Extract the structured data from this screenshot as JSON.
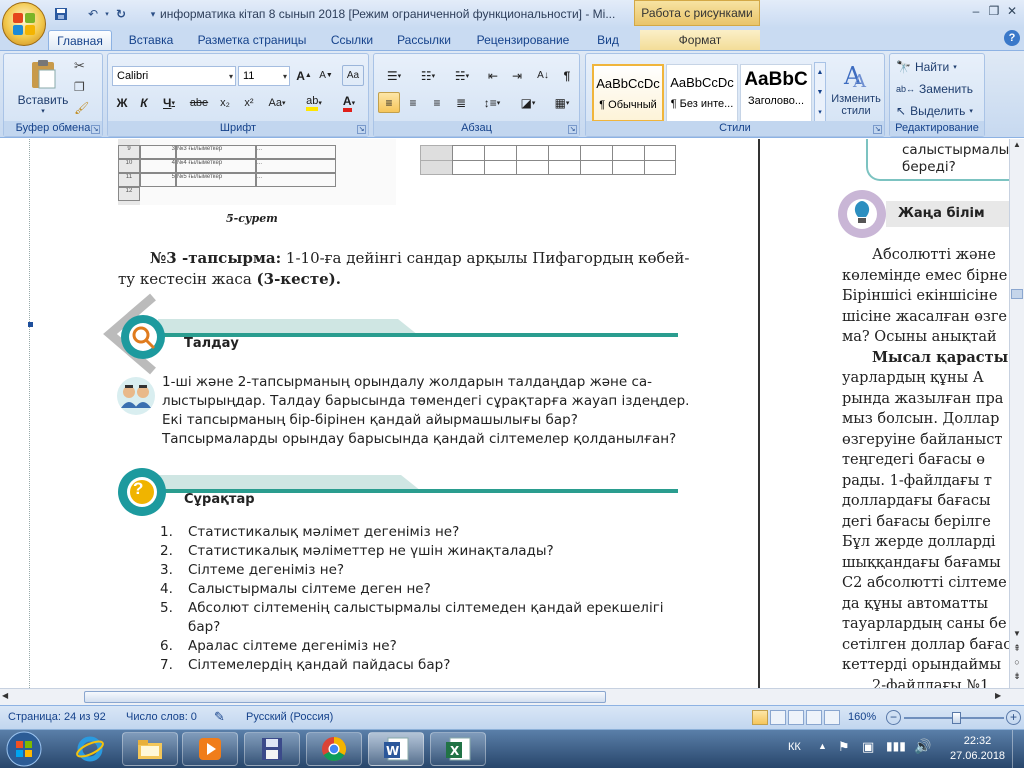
{
  "window": {
    "title": "информатика кітап 8 сынып 2018 [Режим ограниченной функциональности] - Mi...",
    "contextual_title": "Работа с рисунками"
  },
  "tabs": [
    "Главная",
    "Вставка",
    "Разметка страницы",
    "Ссылки",
    "Рассылки",
    "Рецензирование",
    "Вид",
    "Формат"
  ],
  "ribbon": {
    "clipboard": {
      "paste_label": "Вставить",
      "group_label": "Буфер обмена"
    },
    "font": {
      "font_name": "Calibri",
      "font_size": "11",
      "group_label": "Шрифт",
      "bold": "Ж",
      "italic": "К",
      "underline": "Ч",
      "strike": "abe",
      "sub": "x₂",
      "sup": "x²",
      "case": "Aa"
    },
    "paragraph": {
      "group_label": "Абзац"
    },
    "styles": {
      "group_label": "Стили",
      "change_label": "Изменить стили",
      "items": [
        {
          "preview": "AaBbCcDc",
          "name": "¶ Обычный"
        },
        {
          "preview": "AaBbCcDc",
          "name": "¶ Без инте..."
        },
        {
          "preview": "AaBbC",
          "name": "Заголово..."
        }
      ]
    },
    "editing": {
      "group_label": "Редактирование",
      "find": "Найти",
      "replace": "Заменить",
      "select": "Выделить"
    }
  },
  "document": {
    "table_rows": [
      {
        "num": "9",
        "sub": "3",
        "label": "№3 ғылыметкер"
      },
      {
        "num": "10",
        "sub": "4",
        "label": "№4 ғылыметкер"
      },
      {
        "num": "11",
        "sub": "5",
        "label": "№5 ғылыметкер"
      },
      {
        "num": "12",
        "sub": "",
        "label": ""
      }
    ],
    "figure_caption": "5-сурет",
    "task_number": "№3 -тапсырма:",
    "task_text": " 1-10-ға дейінгі сандар арқылы Пифагордың көбей-",
    "task_text2": "ту кестесін жаса ",
    "task_ref": "(3-кесте).",
    "analysis_title": "Талдау",
    "analysis_lines": [
      "1-ші және 2-тапсырманың орындалу жолдарын талдаңдар және са-",
      "лыстырыңдар. Талдау барысында төмендегі сұрақтарға жауап іздеңдер.",
      "Екі тапсырманың бір-бірінен қандай айырмашылығы бар?",
      "Тапсырмаларды орындау барысында қандай сілтемелер қолданылған?"
    ],
    "questions_title": "Сұрақтар",
    "questions": [
      {
        "n": "1.",
        "t": "Статистикалық мәлімет дегеніміз не?"
      },
      {
        "n": "2.",
        "t": "Статистикалық мәліметтер не үшін жинақталады?"
      },
      {
        "n": "3.",
        "t": "Сілтеме дегеніміз не?"
      },
      {
        "n": "4.",
        "t": "Салыстырмалы сілтеме деген не?"
      },
      {
        "n": "5.",
        "t": "Абсолют сілтеменің салыстырмалы сілтемеден қандай ерекшелігі"
      },
      {
        "n": "",
        "t": "бар?"
      },
      {
        "n": "6.",
        "t": "Аралас сілтеме дегеніміз не?"
      },
      {
        "n": "7.",
        "t": "Сілтемелердің қандай пайдасы бар?"
      }
    ],
    "right_top_lines": [
      "салыстырмалы",
      "береді?"
    ],
    "new_knowledge_title": "Жаңа білім",
    "right_lines": [
      "Абсолютті  жәнe",
      "көлемінде емес бірне",
      "Біріншісі екіншісіне",
      "шісіне жасалған өзге",
      "ма? Осыны анықтай",
      "Мысал қарасты",
      "уарлардың құны А",
      "рында жазылған пра",
      "мыз болсын. Доллар",
      "өзгеруіне байланыст",
      "теңгедегі  бағасы  ө",
      "рады. 1-файлдағы т",
      "доллардағы бағасы",
      "дегі бағасы берілге",
      "Бұл жерде долларді",
      "шыққандағы бағамы",
      "C2 абсолютті сілтеме",
      "да құны автоматты",
      "тауарлардың саны бе",
      "сетілген доллар бағас",
      "кеттерді орындаймы",
      "2-файлдағы №1"
    ]
  },
  "status": {
    "page": "Страница: 24 из 92",
    "words": "Число слов: 0",
    "language": "Русский (Россия)",
    "zoom": "160%"
  },
  "taskbar": {
    "lang": "КК",
    "time": "22:32",
    "date": "27.06.2018"
  },
  "colors": {
    "accent": "#1d9a9e",
    "teal_bar": "#2a9d8f",
    "ribbon_bg": "#dfe9f5"
  }
}
